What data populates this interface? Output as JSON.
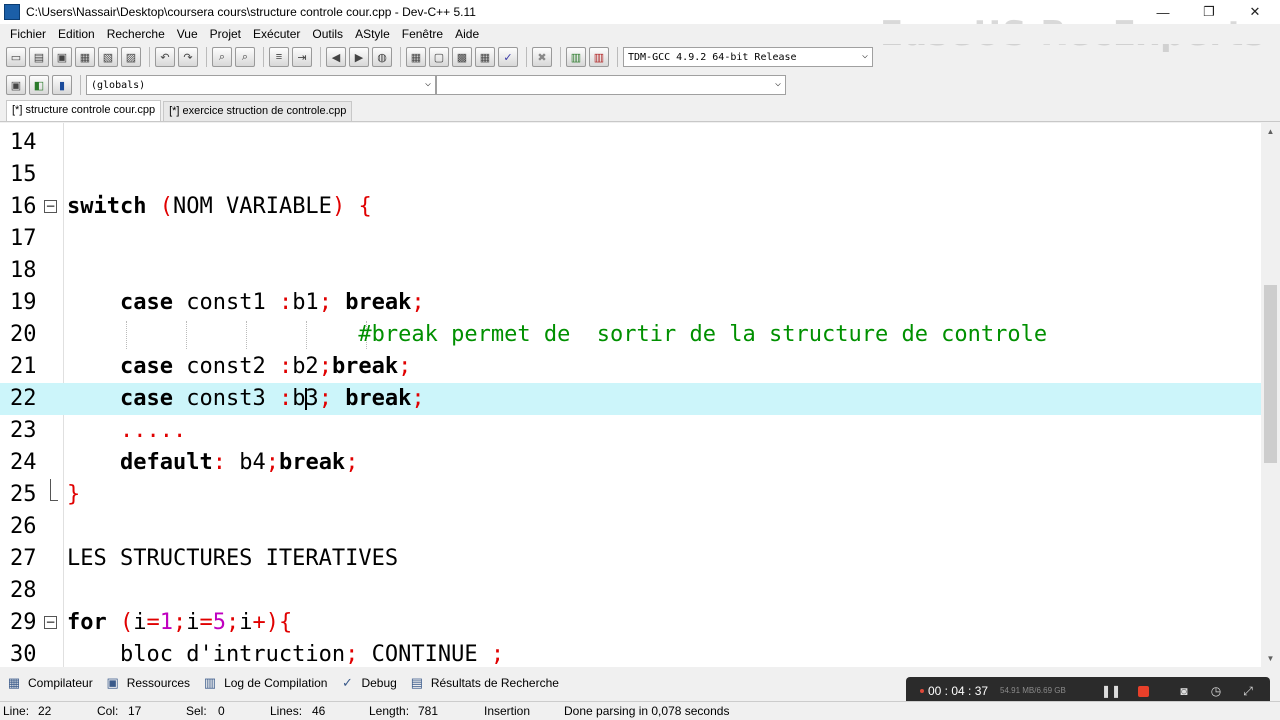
{
  "window": {
    "title": "C:\\Users\\Nassair\\Desktop\\coursera cours\\structure controle cour.cpp - Dev-C++ 5.11",
    "minimize": "—",
    "restore": "❐",
    "close": "✕"
  },
  "watermark": "EaseUS RecExperts",
  "menu": [
    "Fichier",
    "Edition",
    "Recherche",
    "Vue",
    "Projet",
    "Exécuter",
    "Outils",
    "AStyle",
    "Fenêtre",
    "Aide"
  ],
  "toolbar": {
    "compiler_select": "TDM-GCC 4.9.2 64-bit Release",
    "scope_select": "(globals)",
    "symbol_select": ""
  },
  "tabs": [
    {
      "label": "[*] structure controle cour.cpp",
      "active": true
    },
    {
      "label": "[*] exercice struction de controle.cpp",
      "active": false
    }
  ],
  "editor": {
    "lines": [
      {
        "num": "14",
        "code": ""
      },
      {
        "num": "15",
        "code": ""
      },
      {
        "num": "16",
        "code": "switch (NOM VARIABLE) {"
      },
      {
        "num": "17",
        "code": ""
      },
      {
        "num": "18",
        "code": ""
      },
      {
        "num": "19",
        "code": "    case const1 :b1; break;"
      },
      {
        "num": "20",
        "code": "                      #break permet de  sortir de la structure de controle"
      },
      {
        "num": "21",
        "code": "    case const2 :b2;break;"
      },
      {
        "num": "22",
        "code": "    case const3 :b3; break;"
      },
      {
        "num": "23",
        "code": "    ....."
      },
      {
        "num": "24",
        "code": "    default: b4;break;"
      },
      {
        "num": "25",
        "code": "}"
      },
      {
        "num": "26",
        "code": ""
      },
      {
        "num": "27",
        "code": "LES STRUCTURES ITERATIVES"
      },
      {
        "num": "28",
        "code": ""
      },
      {
        "num": "29",
        "code": "for (i=1;i=5;i+){"
      },
      {
        "num": "30",
        "code": "    bloc d'intruction; CONTINUE ;"
      }
    ],
    "current_line": "22"
  },
  "bottom_tabs": [
    {
      "label": "Compilateur",
      "icon": "compiler-grid-icon"
    },
    {
      "label": "Ressources",
      "icon": "resources-icon"
    },
    {
      "label": "Log de Compilation",
      "icon": "bar-chart-icon"
    },
    {
      "label": "Debug",
      "icon": "check-icon"
    },
    {
      "label": "Résultats de Recherche",
      "icon": "search-results-icon"
    }
  ],
  "statusbar": {
    "line_label": "Line:",
    "line_value": "22",
    "col_label": "Col:",
    "col_value": "17",
    "sel_label": "Sel:",
    "sel_value": "0",
    "lines_label": "Lines:",
    "lines_value": "46",
    "length_label": "Length:",
    "length_value": "781",
    "mode": "Insertion",
    "message": "Done parsing in 0,078 seconds"
  },
  "recorder": {
    "time": "00 : 04 : 37",
    "storage": "54.91 MB/6.69 GB",
    "record_color": "#e8402a"
  },
  "colors": {
    "current_line": "#ccf5fa",
    "keyword": "#000000",
    "symbol": "#e00000",
    "number": "#c000c0",
    "comment": "#009000"
  }
}
